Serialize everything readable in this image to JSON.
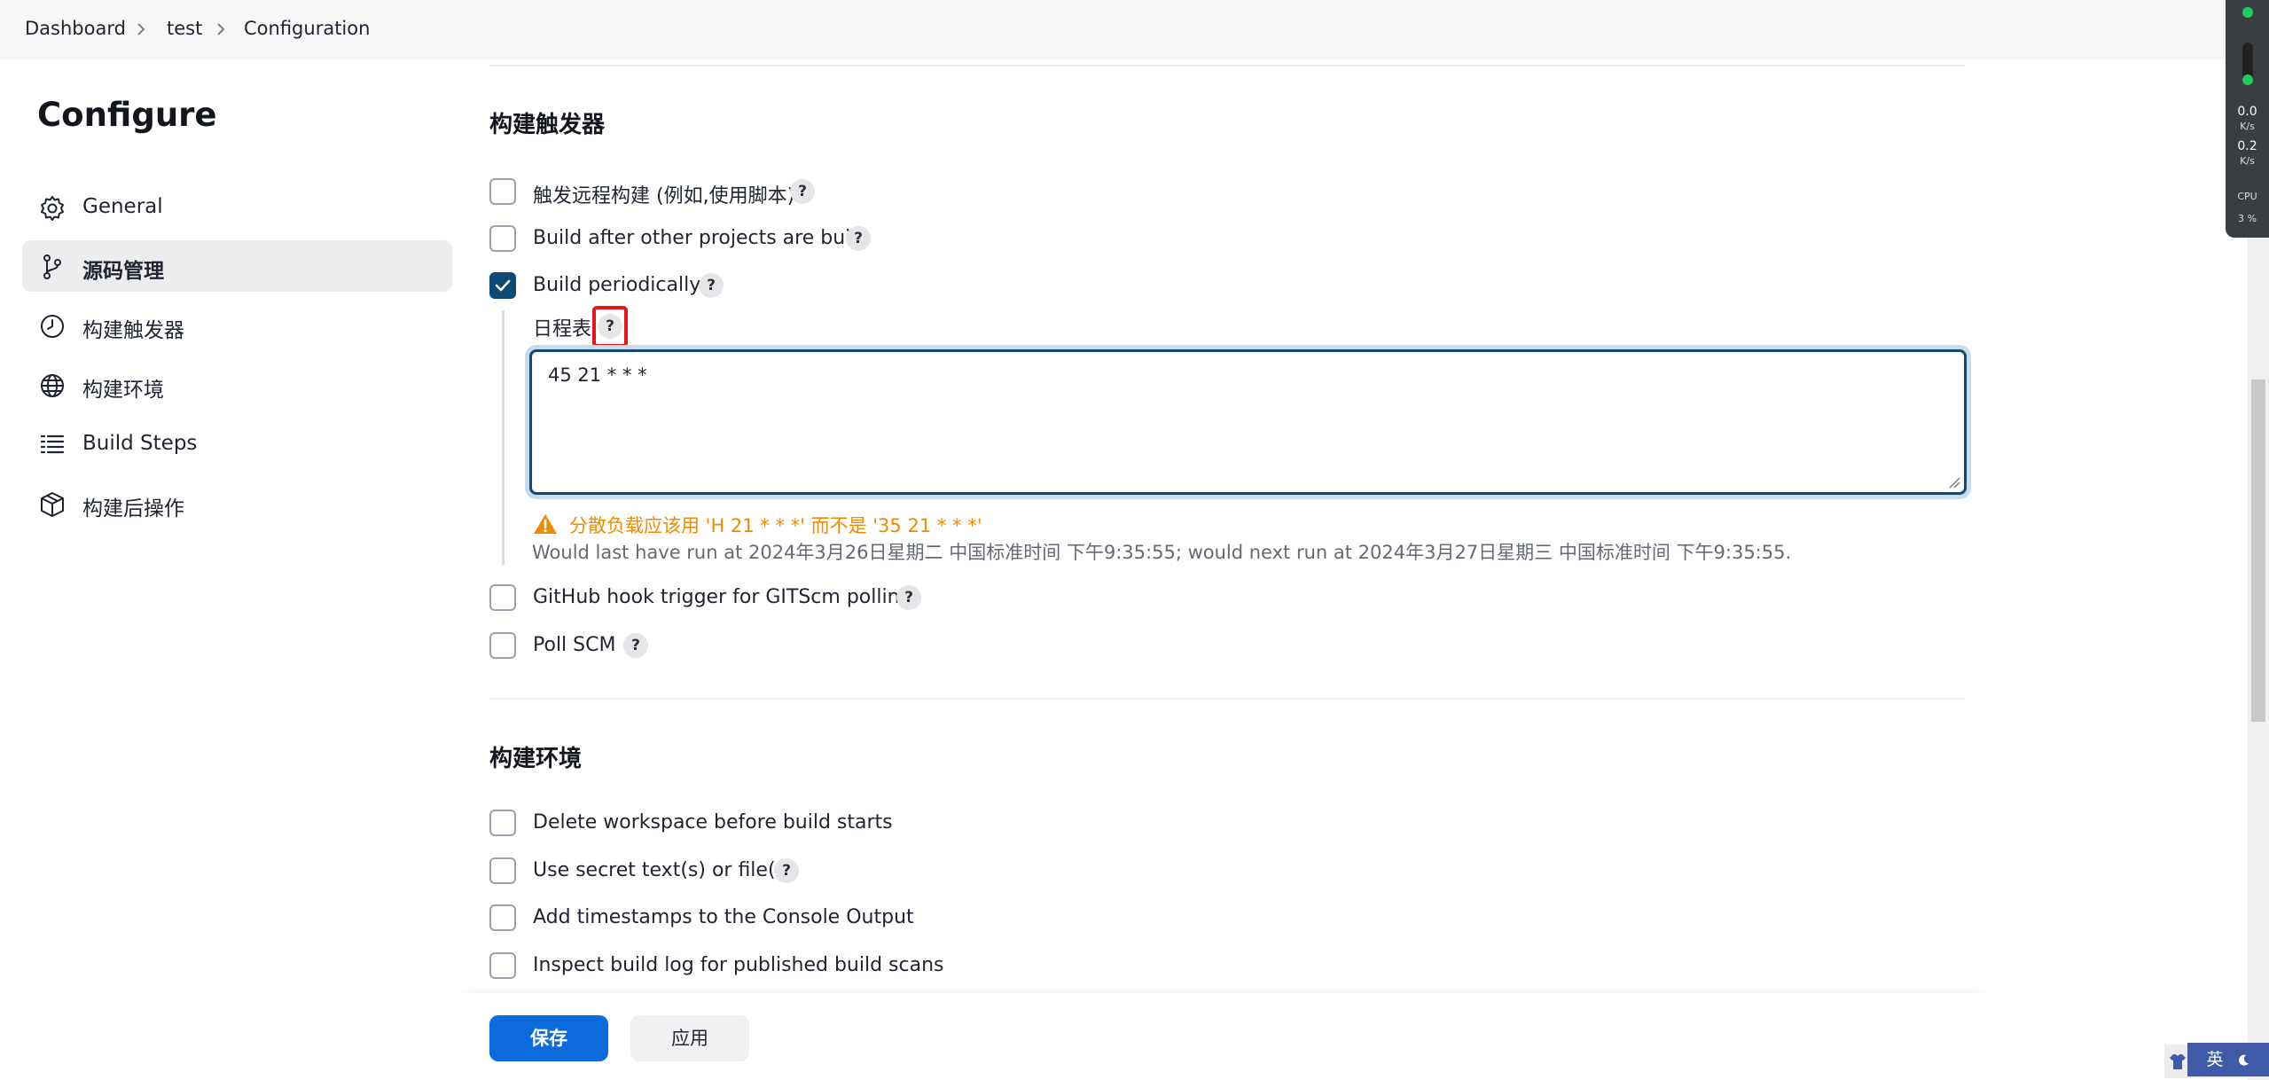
{
  "breadcrumb": {
    "items": [
      "Dashboard",
      "test",
      "Configuration"
    ]
  },
  "monitor": {
    "up_value": "0.0",
    "up_unit": "K/s",
    "down_value": "0.2",
    "down_unit": "K/s",
    "cpu_label": "CPU",
    "cpu_value": "3 %"
  },
  "sidebar": {
    "title": "Configure",
    "items": [
      {
        "label": "General",
        "icon": "gear-icon"
      },
      {
        "label": "源码管理",
        "icon": "branch-icon",
        "active": true
      },
      {
        "label": "构建触发器",
        "icon": "clock-icon"
      },
      {
        "label": "构建环境",
        "icon": "globe-icon"
      },
      {
        "label": "Build Steps",
        "icon": "list-icon"
      },
      {
        "label": "构建后操作",
        "icon": "package-icon"
      }
    ]
  },
  "triggers": {
    "title": "构建触发器",
    "items": [
      {
        "label": "触发远程构建 (例如,使用脚本)",
        "checked": false,
        "help": "?"
      },
      {
        "label": "Build after other projects are built",
        "checked": false,
        "help": "?"
      },
      {
        "label": "Build periodically",
        "checked": true,
        "help": "?"
      },
      {
        "label": "GitHub hook trigger for GITScm polling",
        "checked": false,
        "help": "?"
      },
      {
        "label": "Poll SCM",
        "checked": false,
        "help": "?"
      }
    ],
    "schedule": {
      "label": "日程表",
      "help": "?",
      "value": "45 21 * * *",
      "warning": "分散负载应该用 'H 21 * * *' 而不是 '35 21 * * *'",
      "info": "Would last have run at 2024年3月26日星期二 中国标准时间 下午9:35:55; would next run at 2024年3月27日星期三 中国标准时间 下午9:35:55."
    }
  },
  "environment": {
    "title": "构建环境",
    "items": [
      {
        "label": "Delete workspace before build starts",
        "checked": false
      },
      {
        "label": "Use secret text(s) or file(s)",
        "checked": false,
        "help": "?"
      },
      {
        "label": "Add timestamps to the Console Output",
        "checked": false
      },
      {
        "label": "Inspect build log for published build scans",
        "checked": false
      }
    ]
  },
  "actions": {
    "save": "保存",
    "apply": "应用"
  },
  "tray": {
    "lang": "英"
  },
  "colors": {
    "primary": "#0b6bdc",
    "checkbox_checked": "#0e4a73",
    "warning": "#f08a00",
    "highlight": "#e8141a"
  }
}
